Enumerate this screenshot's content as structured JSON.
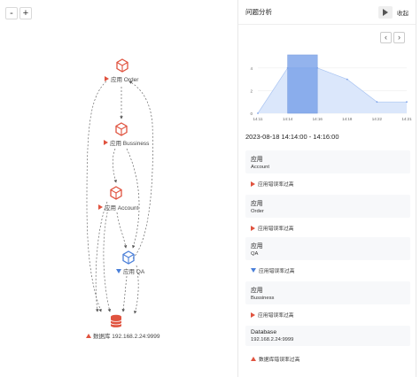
{
  "zoom": {
    "out": "-",
    "in": "+"
  },
  "topology": {
    "nodes": {
      "order": {
        "label": "应用 Order",
        "color": "#e0533f"
      },
      "bussiness": {
        "label": "应用 Bussiness",
        "color": "#e0533f"
      },
      "account": {
        "label": "应用 Account",
        "color": "#e0533f"
      },
      "qa": {
        "label": "应用 QA",
        "color": "#4a7fd9"
      },
      "db": {
        "label": "数据库 192.168.2.24:9999",
        "color": "#e0533f"
      }
    }
  },
  "panel": {
    "title": "问题分析",
    "collapse": "收起",
    "prev": "‹",
    "next": "›",
    "range": "2023-08-18 14:14:00 - 14:16:00"
  },
  "chart_data": {
    "type": "area",
    "x": [
      "14:11",
      "14:14",
      "14:16",
      "14:18",
      "14:22",
      "14:21"
    ],
    "values": [
      0,
      4,
      4,
      3,
      1,
      1
    ],
    "yticks": [
      "0",
      "2",
      "4"
    ],
    "ylim": [
      0,
      5
    ],
    "highlight": [
      "14:14",
      "14:16"
    ],
    "colors": {
      "fill": "#dbe7fb",
      "line": "#a9c4f2",
      "highlight": "#6f9ae8"
    }
  },
  "cards": [
    {
      "type": "应用",
      "name": "Account",
      "alert": "应用错误率过高",
      "level": "red"
    },
    {
      "type": "应用",
      "name": "Order",
      "alert": "应用错误率过高",
      "level": "red"
    },
    {
      "type": "应用",
      "name": "QA",
      "alert": "应用错误率过高",
      "level": "blue"
    },
    {
      "type": "应用",
      "name": "Bussiness",
      "alert": "应用错误率过高",
      "level": "red"
    },
    {
      "type": "Database",
      "name": "192.168.2.24:9999",
      "alert": "数据库错误率过高",
      "level": "red-up"
    }
  ]
}
